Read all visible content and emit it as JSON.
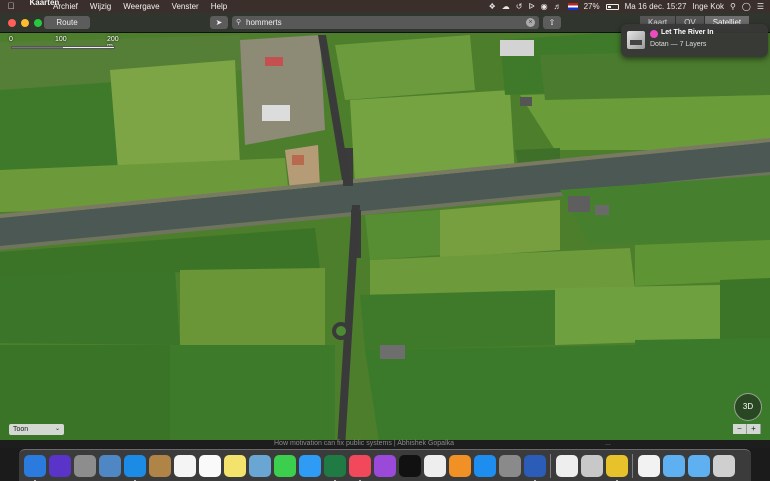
{
  "menubar": {
    "app_name": "Kaarten",
    "menus": [
      "Archief",
      "Wijzig",
      "Weergave",
      "Venster",
      "Help"
    ],
    "battery": "27%",
    "datetime": "Ma 16 dec.  15:27",
    "user": "Inge Kok"
  },
  "toolbar": {
    "route_label": "Route",
    "search": {
      "value": "hommerts",
      "placeholder": ""
    },
    "segments": [
      "Kaart",
      "OV",
      "Satelliet"
    ],
    "selected_segment": "Satelliet"
  },
  "scale": {
    "labels": [
      "0",
      "100",
      "200 m"
    ]
  },
  "notification": {
    "title": "Let The River In",
    "subtitle": "Dotan — 7 Layers"
  },
  "map_controls": {
    "mode_select": "Toon",
    "btn_3d": "3D",
    "zoom_out": "−",
    "zoom_in": "+"
  },
  "background_window": {
    "title": "How motivation can fix public systems | Abhishek Gopalka",
    "right": "..."
  },
  "dock": {
    "apps": [
      {
        "name": "finder",
        "color": "#2b7bde",
        "running": true
      },
      {
        "name": "siri",
        "color": "#5a34c8",
        "running": false
      },
      {
        "name": "launchpad",
        "color": "#8d8d8d",
        "running": false
      },
      {
        "name": "preview",
        "color": "#4f87c5",
        "running": false
      },
      {
        "name": "safari",
        "color": "#1c8be6",
        "running": true
      },
      {
        "name": "notes-brown",
        "color": "#b08447",
        "running": false
      },
      {
        "name": "calendar",
        "color": "#f4f4f4",
        "running": false
      },
      {
        "name": "reminders",
        "color": "#fafafa",
        "running": false
      },
      {
        "name": "stickies",
        "color": "#f3e36c",
        "running": false
      },
      {
        "name": "preview-photos",
        "color": "#6aa6d4",
        "running": false
      },
      {
        "name": "facetime",
        "color": "#3ccf4e",
        "running": false
      },
      {
        "name": "messages",
        "color": "#2e9cf5",
        "running": false
      },
      {
        "name": "excel",
        "color": "#1f7a44",
        "running": true
      },
      {
        "name": "music",
        "color": "#f2485b",
        "running": true
      },
      {
        "name": "podcasts",
        "color": "#9a49d9",
        "running": false
      },
      {
        "name": "apple-tv",
        "color": "#111111",
        "running": false
      },
      {
        "name": "photos",
        "color": "#eeeeee",
        "running": false
      },
      {
        "name": "books",
        "color": "#f09025",
        "running": false
      },
      {
        "name": "app-store",
        "color": "#1d8ef0",
        "running": false
      },
      {
        "name": "system-preferences",
        "color": "#8a8a8a",
        "running": false
      },
      {
        "name": "word",
        "color": "#2a5cb8",
        "running": true
      },
      {
        "name": "sep",
        "color": "",
        "running": false
      },
      {
        "name": "textedit",
        "color": "#eeeeee",
        "running": false
      },
      {
        "name": "image-capture",
        "color": "#c8c8c8",
        "running": false
      },
      {
        "name": "chrome",
        "color": "#e8c22b",
        "running": true
      },
      {
        "name": "sep",
        "color": "",
        "running": false
      },
      {
        "name": "document",
        "color": "#f2f2f2",
        "running": false
      },
      {
        "name": "folder-1",
        "color": "#5fb0f0",
        "running": false
      },
      {
        "name": "folder-2",
        "color": "#5fb0f0",
        "running": false
      },
      {
        "name": "trash",
        "color": "#cfcfcf",
        "running": false
      }
    ]
  },
  "colors": {
    "menubar_bg": "#3a2f2b",
    "field_light": "#6c9a3a",
    "field_dark": "#3f7a2a",
    "river": "#4a5650"
  }
}
